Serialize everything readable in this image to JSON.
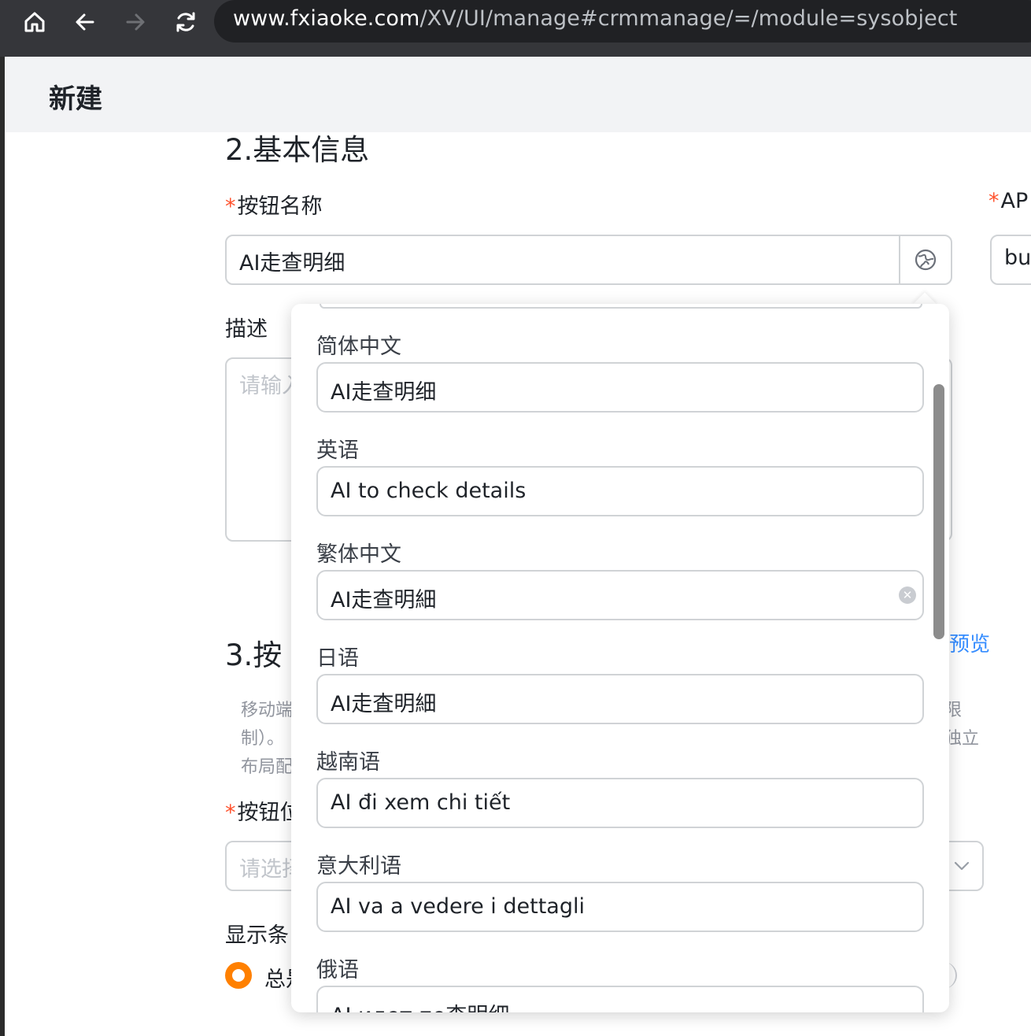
{
  "browser": {
    "url_host": "www.fxiaoke.com",
    "url_path": "/XV/UI/manage#crmmanage/=/module=sysobject"
  },
  "page": {
    "title": "新建"
  },
  "section2": {
    "title": "2.基本信息",
    "button_name_label": "按钮名称",
    "button_name_value": "AI走查明细",
    "api_label_partial": "AP",
    "api_value_partial": "but",
    "description_label": "描述",
    "description_placeholder_partial": "请输入"
  },
  "section3": {
    "title_partial": "3.按",
    "preview_link": "预览",
    "hint_lines_left": [
      "移动端",
      "制）。",
      "布局配"
    ],
    "hint_lines_right": [
      "限",
      "独立"
    ],
    "position_label_partial": "按钮位",
    "position_placeholder_partial": "请选择",
    "display_condition_partial": "显示条",
    "radio_label_partial": "总是"
  },
  "translations": [
    {
      "lang": "简体中文",
      "value": "AI走查明细"
    },
    {
      "lang": "英语",
      "value": "AI to check details"
    },
    {
      "lang": "繁体中文",
      "value": "AI走查明細"
    },
    {
      "lang": "日语",
      "value": "AI走査明細"
    },
    {
      "lang": "越南语",
      "value": "AI đi xem chi tiết"
    },
    {
      "lang": "意大利语",
      "value": "AI va a vedere i dettagli"
    },
    {
      "lang": "俄语",
      "value": "AI идет по查明细"
    }
  ],
  "colors": {
    "required_star": "#ff522d",
    "link": "#368dff",
    "radio": "#ff8000"
  }
}
